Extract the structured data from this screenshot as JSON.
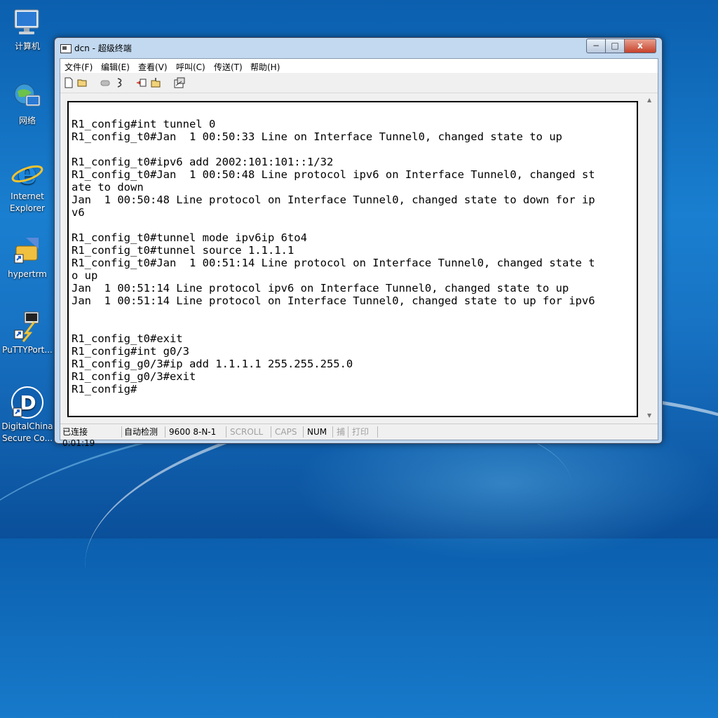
{
  "desktop": {
    "icons": [
      {
        "label": "计算机",
        "icon": "computer-icon"
      },
      {
        "label": "网络",
        "icon": "network-icon"
      },
      {
        "label": "Internet Explorer",
        "icon": "internet-explorer-icon"
      },
      {
        "label": "hypertrm",
        "icon": "hyperterminal-icon"
      },
      {
        "label": "PuTTYPort...",
        "icon": "putty-icon"
      },
      {
        "label": "DigitalChina Secure Co...",
        "icon": "digitalchina-icon"
      }
    ]
  },
  "window": {
    "title": "dcn - 超级终端",
    "controls": {
      "minimize": "−",
      "maximize": "□",
      "close": "x"
    }
  },
  "menu": {
    "items": [
      "文件(F)",
      "编辑(E)",
      "查看(V)",
      "呼叫(C)",
      "传送(T)",
      "帮助(H)"
    ]
  },
  "toolbar": {
    "buttons": [
      "new-icon",
      "open-icon",
      "disconnect-icon",
      "dial-icon",
      "send-icon",
      "receive-icon",
      "properties-icon"
    ]
  },
  "terminal": {
    "lines": [
      "R1_config#int tunnel 0",
      "R1_config_t0#Jan  1 00:50:33 Line on Interface Tunnel0, changed state to up",
      "",
      "R1_config_t0#ipv6 add 2002:101:101::1/32",
      "R1_config_t0#Jan  1 00:50:48 Line protocol ipv6 on Interface Tunnel0, changed st",
      "ate to down",
      "Jan  1 00:50:48 Line protocol on Interface Tunnel0, changed state to down for ip",
      "v6",
      "",
      "R1_config_t0#tunnel mode ipv6ip 6to4",
      "R1_config_t0#tunnel source 1.1.1.1",
      "R1_config_t0#Jan  1 00:51:14 Line protocol on Interface Tunnel0, changed state t",
      "o up",
      "Jan  1 00:51:14 Line protocol ipv6 on Interface Tunnel0, changed state to up",
      "Jan  1 00:51:14 Line protocol on Interface Tunnel0, changed state to up for ipv6",
      "",
      "",
      "R1_config_t0#exit",
      "R1_config#int g0/3",
      "R1_config_g0/3#ip add 1.1.1.1 255.255.255.0",
      "R1_config_g0/3#exit",
      "R1_config#"
    ]
  },
  "status": {
    "connection": "已连接 0:01:19",
    "detect": "自动检测",
    "port": "9600 8-N-1",
    "scroll": "SCROLL",
    "caps": "CAPS",
    "num": "NUM",
    "capture": "捕",
    "print": "打印"
  }
}
